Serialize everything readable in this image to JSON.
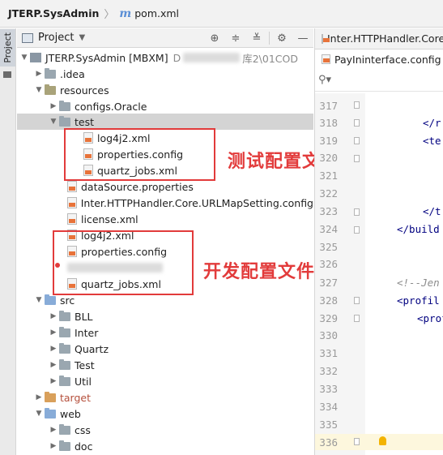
{
  "breadcrumb": {
    "project": "JTERP.SysAdmin",
    "file": "pom.xml"
  },
  "tool_window": {
    "stripe_tab": "Project",
    "header_title": "Project",
    "buttons": [
      "crosshair-icon",
      "expand-icon",
      "collapse-icon",
      "gear-icon",
      "minus-icon"
    ]
  },
  "tree": {
    "root_label": "JTERP.SysAdmin [MBXM]",
    "root_path_visible": "D",
    "root_path_tail": "库2\\01COD",
    "idea": ".idea",
    "resources": "resources",
    "configs_oracle": "configs.Oracle",
    "test": "test",
    "test_log4j2": "log4j2.xml",
    "test_properties": "properties.config",
    "test_quartz": "quartz_jobs.xml",
    "datasource": "dataSource.properties",
    "inter_urlmap": "Inter.HTTPHandler.Core.URLMapSetting.config",
    "license": "license.xml",
    "log4j2": "log4j2.xml",
    "properties": "properties.config",
    "quartz": "quartz_jobs.xml",
    "src": "src",
    "bll": "BLL",
    "inter": "Inter",
    "quartz_folder": "Quartz",
    "test_folder": "Test",
    "util": "Util",
    "target": "target",
    "web": "web",
    "css": "css",
    "doc": "doc"
  },
  "annotations": {
    "test_config": "测试配置文件",
    "dev_config": "开发配置文件",
    "color": "#e23b3b"
  },
  "editor": {
    "tabs": [
      "Inter.HTTPHandler.Core",
      "PayIninterface.config"
    ],
    "search_icon": "search-icon",
    "line_numbers": [
      "317",
      "318",
      "319",
      "320",
      "321",
      "322",
      "323",
      "324",
      "325",
      "326",
      "327",
      "328",
      "329",
      "330",
      "331",
      "332",
      "333",
      "334",
      "335",
      "336"
    ],
    "code": {
      "l318": "</r",
      "l319": "<te",
      "l323": "</t",
      "l324": "</build",
      "l327": "<!--Jen",
      "l328": "<profil",
      "l329": "<prof"
    }
  }
}
